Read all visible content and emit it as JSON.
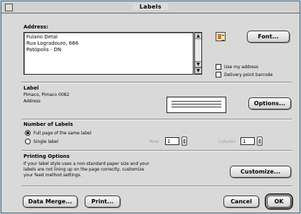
{
  "window": {
    "title": "Labels"
  },
  "address": {
    "heading": "Address:",
    "lines": [
      "Fulano Detal",
      "Rua Logradouro, 666",
      "Patópolis - DN"
    ],
    "font_button": "Font...",
    "use_my_address": "Use my address",
    "delivery_point_barcode": "Delivery point barcode"
  },
  "label": {
    "heading": "Label",
    "product": "Pimaco, Pimaco 0082",
    "type": "Address",
    "options_button": "Options..."
  },
  "number_of_labels": {
    "heading": "Number of Labels",
    "full_page": "Full page of the same label",
    "single_label": "Single label",
    "row_label": "Row:",
    "row_value": "1",
    "column_label": "Column:",
    "column_value": "1"
  },
  "printing_options": {
    "heading": "Printing Options",
    "text_line1": "If your label style uses a non-standard paper size and your",
    "text_line2": "labels are not lining up on the page correctly, customize",
    "text_line3": "your feed method settings.",
    "customize_button": "Customize..."
  },
  "footer": {
    "data_merge_button": "Data Merge...",
    "print_button": "Print...",
    "cancel_button": "Cancel",
    "ok_button": "OK"
  }
}
